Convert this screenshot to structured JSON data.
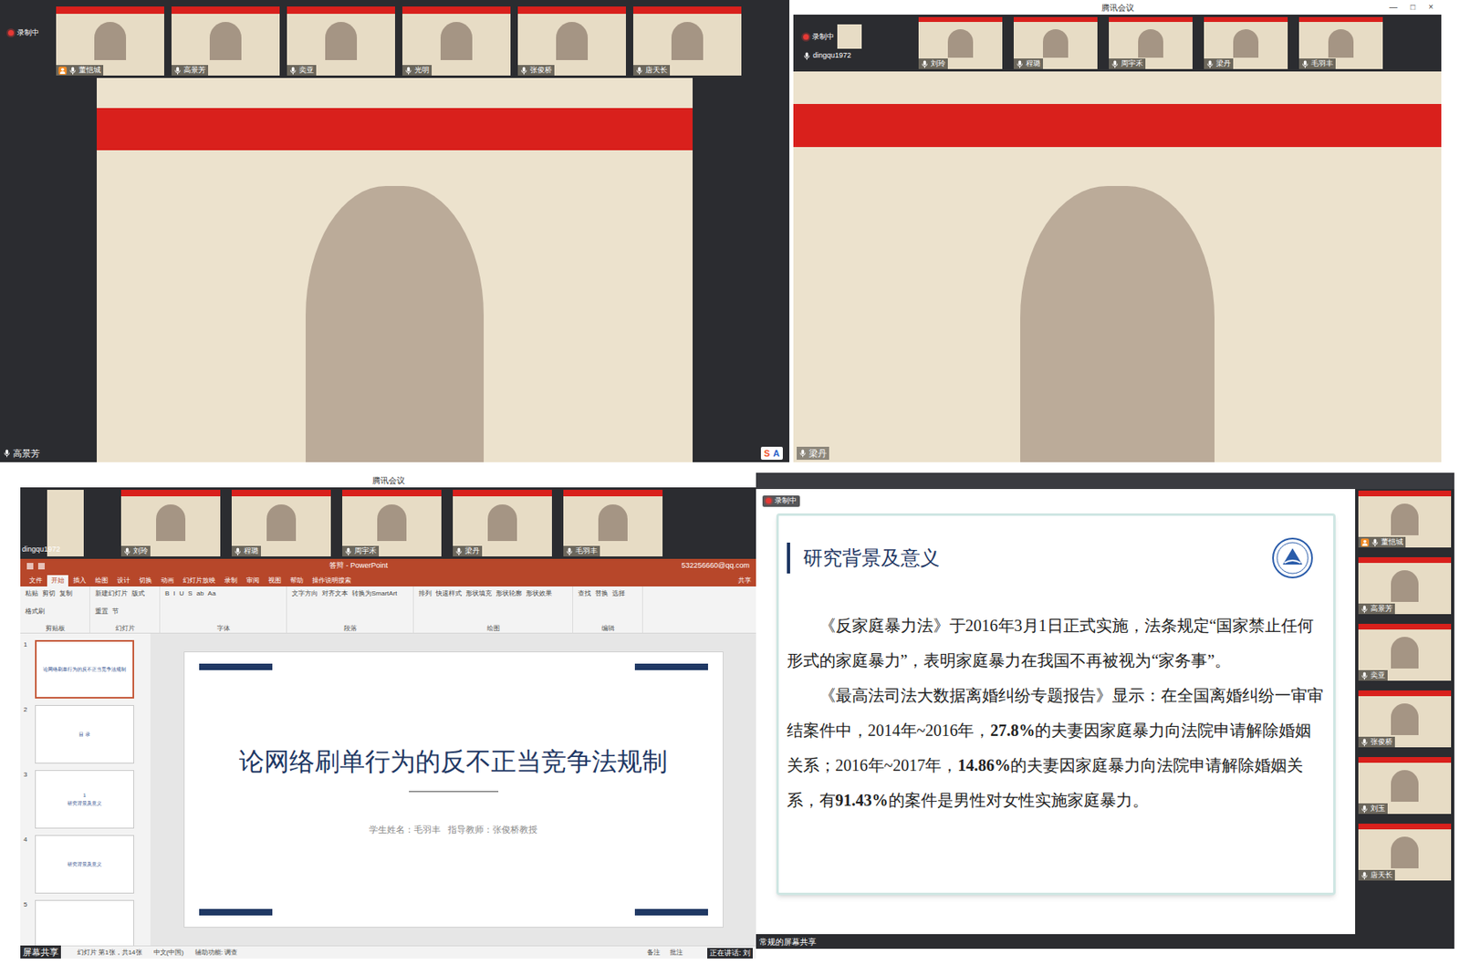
{
  "screen1": {
    "recording": "录制中",
    "speaker": "高景芳",
    "ime": [
      "S",
      "A"
    ],
    "thumbs": [
      {
        "name": "董恺城",
        "host": true
      },
      {
        "name": "高景芳",
        "host": false
      },
      {
        "name": "奕亚",
        "host": false
      },
      {
        "name": "光明",
        "host": false
      },
      {
        "name": "张俊桥",
        "host": false
      },
      {
        "name": "唐天长",
        "host": false
      }
    ]
  },
  "screen2": {
    "title": "腾讯会议",
    "controls": [
      "—",
      "□",
      "×"
    ],
    "recording": "录制中",
    "self": "dingqu1972",
    "speaker": "梁丹",
    "thumbs": [
      {
        "name": "刘玲"
      },
      {
        "name": "程璐"
      },
      {
        "name": "周宇禾"
      },
      {
        "name": "梁丹"
      },
      {
        "name": "毛羽丰"
      }
    ]
  },
  "screen3": {
    "title": "腾讯会议",
    "self": "dingqu1972",
    "share_label": "屏幕共享",
    "speaking": "正在讲话: 刘",
    "thumbs": [
      {
        "name": "刘玲"
      },
      {
        "name": "程璐"
      },
      {
        "name": "周宇禾"
      },
      {
        "name": "梁丹"
      },
      {
        "name": "毛羽丰"
      }
    ],
    "ppt": {
      "window_title": "答辩 - PowerPoint",
      "account": "532256660@qq.com",
      "share": "共享",
      "tabs": [
        {
          "label": "文件",
          "selected": false
        },
        {
          "label": "开始",
          "selected": true
        },
        {
          "label": "插入",
          "selected": false
        },
        {
          "label": "绘图",
          "selected": false
        },
        {
          "label": "设计",
          "selected": false
        },
        {
          "label": "切换",
          "selected": false
        },
        {
          "label": "动画",
          "selected": false
        },
        {
          "label": "幻灯片放映",
          "selected": false
        },
        {
          "label": "录制",
          "selected": false
        },
        {
          "label": "审阅",
          "selected": false
        },
        {
          "label": "视图",
          "selected": false
        },
        {
          "label": "帮助",
          "selected": false
        },
        {
          "label": "操作说明搜索",
          "selected": false
        }
      ],
      "groups": [
        {
          "label": "剪贴板",
          "buttons": [
            "粘贴",
            "剪切",
            "复制",
            "格式刷"
          ]
        },
        {
          "label": "幻灯片",
          "buttons": [
            "新建幻灯片",
            "版式",
            "重置",
            "节"
          ]
        },
        {
          "label": "字体",
          "buttons": [
            "B",
            "I",
            "U",
            "S",
            "ab",
            "Aa"
          ]
        },
        {
          "label": "段落",
          "buttons": [
            "文字方向",
            "对齐文本",
            "转换为SmartArt"
          ]
        },
        {
          "label": "绘图",
          "buttons": [
            "排列",
            "快速样式",
            "形状填充",
            "形状轮廓",
            "形状效果"
          ]
        },
        {
          "label": "编辑",
          "buttons": [
            "查找",
            "替换",
            "选择"
          ]
        }
      ],
      "slides": [
        {
          "num": "1",
          "lines": [
            "论网络刷单行为的反不正当竞争法规制"
          ],
          "selected": true
        },
        {
          "num": "2",
          "lines": [
            "目 录"
          ],
          "selected": false
        },
        {
          "num": "3",
          "lines": [
            "1",
            "研究背景及意义"
          ],
          "selected": false
        },
        {
          "num": "4",
          "lines": [
            "研究背景及意义"
          ],
          "selected": false
        },
        {
          "num": "5",
          "lines": [],
          "selected": false
        }
      ],
      "slide": {
        "title": "论网络刷单行为的反不正当竞争法规制",
        "subtitle": "学生姓名：毛羽丰   指导教师：张俊桥教授"
      },
      "status": [
        "幻灯片 第1张，共14张",
        "中文(中国)",
        "辅助功能: 调查"
      ],
      "status_right": [
        "备注",
        "批注"
      ]
    }
  },
  "screen4": {
    "recording": "录制中",
    "share_label": "常规的屏幕共享",
    "slide": {
      "title": "研究背景及意义",
      "paragraphs": [
        [
          {
            "text": "《反家庭暴力法》于2016年3月1日正式实施，法条规定“国家禁止任何形式的家庭暴力”，表明家庭暴力在我国不再被视为“家务事”。",
            "bold": false
          }
        ],
        [
          {
            "text": "《最高法司法大数据离婚纠纷专题报告》显示：在全国离婚纠纷一审审结案件中，2014年~2016年，",
            "bold": false
          },
          {
            "text": "27.8%",
            "bold": true
          },
          {
            "text": "的夫妻因家庭暴力向法院申请解除婚姻关系；2016年~2017年，",
            "bold": false
          },
          {
            "text": "14.86%",
            "bold": true
          },
          {
            "text": "的夫妻因家庭暴力向法院申请解除婚姻关系，有",
            "bold": false
          },
          {
            "text": "91.43%",
            "bold": true
          },
          {
            "text": "的案件是男性对女性实施家庭暴力。",
            "bold": false
          }
        ]
      ]
    },
    "thumbs": [
      {
        "name": "董恺城",
        "host": true
      },
      {
        "name": "高景芳",
        "host": false
      },
      {
        "name": "奕亚",
        "host": false
      },
      {
        "name": "张俊桥",
        "host": false
      },
      {
        "name": "刘玉",
        "host": false
      },
      {
        "name": "唐天长",
        "host": false
      }
    ]
  }
}
